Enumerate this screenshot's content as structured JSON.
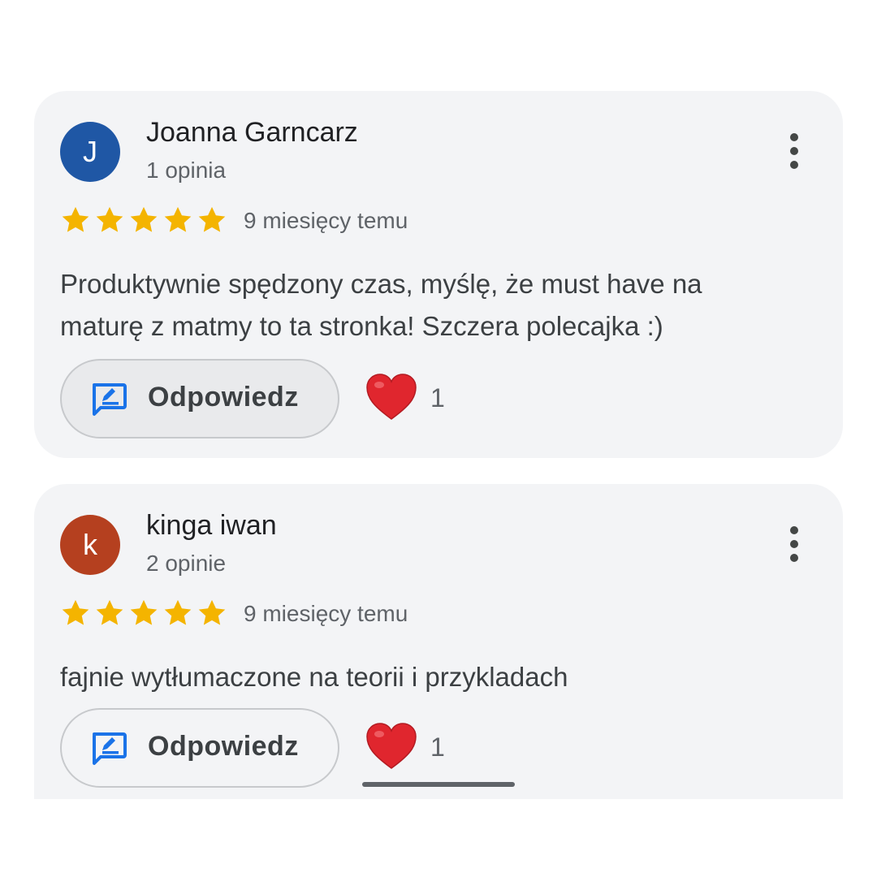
{
  "reviews": [
    {
      "avatar_letter": "J",
      "avatar_color": "#1f57a5",
      "author": "Joanna Garncarz",
      "review_count": "1 opinia",
      "rating": 5,
      "time": "9 miesięcy temu",
      "text": "Produktywnie spędzony czas, myślę, że must have na maturę z matmy to ta stronka! Szczera polecajka :)",
      "reply_label": "Odpowiedz",
      "likes": "1"
    },
    {
      "avatar_letter": "k",
      "avatar_color": "#b5401f",
      "author": "kinga iwan",
      "review_count": "2 opinie",
      "rating": 5,
      "time": "9 miesięcy temu",
      "text": "fajnie wytłumaczone na teorii i przykladach",
      "reply_label": "Odpowiedz",
      "likes": "1"
    }
  ],
  "colors": {
    "star": "#f4b400",
    "heart": "#e0262e",
    "reply_icon": "#1a73e8"
  },
  "icons": {
    "more": "more-vert-icon",
    "star": "star-icon",
    "reply": "reply-comment-icon",
    "heart": "heart-icon"
  }
}
